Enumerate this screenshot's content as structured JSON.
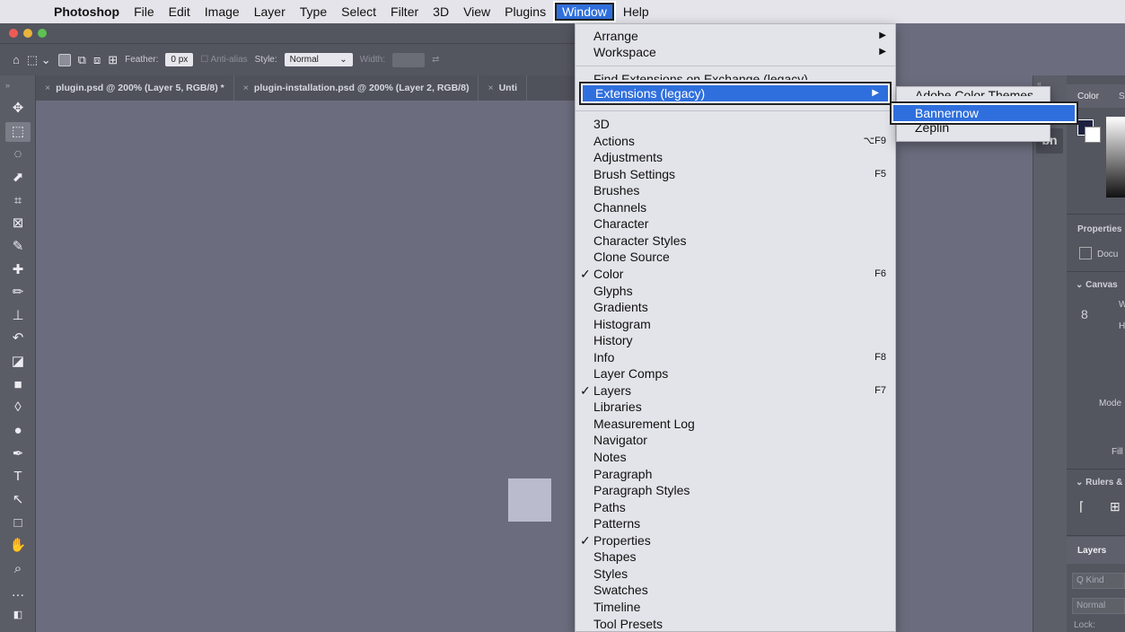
{
  "menubar": {
    "app_name": "Photoshop",
    "items": [
      "File",
      "Edit",
      "Image",
      "Layer",
      "Type",
      "Select",
      "Filter",
      "3D",
      "View",
      "Plugins",
      "Window",
      "Help"
    ]
  },
  "options_bar": {
    "feather_label": "Feather:",
    "feather_value": "0 px",
    "anti_alias_label": "Anti-alias",
    "style_label": "Style:",
    "style_value": "Normal",
    "width_label": "Width:"
  },
  "tabs": [
    "plugin.psd @ 200% (Layer 5, RGB/8) *",
    "plugin-installation.psd @ 200% (Layer 2, RGB/8)",
    "Unti"
  ],
  "window_menu": {
    "arrange": "Arrange",
    "workspace": "Workspace",
    "find_extensions": "Find Extensions on Exchange (legacy)...",
    "extensions_legacy": "Extensions (legacy)",
    "items": [
      {
        "label": "3D",
        "shortcut": "",
        "checked": false
      },
      {
        "label": "Actions",
        "shortcut": "⌥F9",
        "checked": false
      },
      {
        "label": "Adjustments",
        "shortcut": "",
        "checked": false
      },
      {
        "label": "Brush Settings",
        "shortcut": "F5",
        "checked": false
      },
      {
        "label": "Brushes",
        "shortcut": "",
        "checked": false
      },
      {
        "label": "Channels",
        "shortcut": "",
        "checked": false
      },
      {
        "label": "Character",
        "shortcut": "",
        "checked": false
      },
      {
        "label": "Character Styles",
        "shortcut": "",
        "checked": false
      },
      {
        "label": "Clone Source",
        "shortcut": "",
        "checked": false
      },
      {
        "label": "Color",
        "shortcut": "F6",
        "checked": true
      },
      {
        "label": "Glyphs",
        "shortcut": "",
        "checked": false
      },
      {
        "label": "Gradients",
        "shortcut": "",
        "checked": false
      },
      {
        "label": "Histogram",
        "shortcut": "",
        "checked": false
      },
      {
        "label": "History",
        "shortcut": "",
        "checked": false
      },
      {
        "label": "Info",
        "shortcut": "F8",
        "checked": false
      },
      {
        "label": "Layer Comps",
        "shortcut": "",
        "checked": false
      },
      {
        "label": "Layers",
        "shortcut": "F7",
        "checked": true
      },
      {
        "label": "Libraries",
        "shortcut": "",
        "checked": false
      },
      {
        "label": "Measurement Log",
        "shortcut": "",
        "checked": false
      },
      {
        "label": "Navigator",
        "shortcut": "",
        "checked": false
      },
      {
        "label": "Notes",
        "shortcut": "",
        "checked": false
      },
      {
        "label": "Paragraph",
        "shortcut": "",
        "checked": false
      },
      {
        "label": "Paragraph Styles",
        "shortcut": "",
        "checked": false
      },
      {
        "label": "Paths",
        "shortcut": "",
        "checked": false
      },
      {
        "label": "Patterns",
        "shortcut": "",
        "checked": false
      },
      {
        "label": "Properties",
        "shortcut": "",
        "checked": true
      },
      {
        "label": "Shapes",
        "shortcut": "",
        "checked": false
      },
      {
        "label": "Styles",
        "shortcut": "",
        "checked": false
      },
      {
        "label": "Swatches",
        "shortcut": "",
        "checked": false
      },
      {
        "label": "Timeline",
        "shortcut": "",
        "checked": false
      },
      {
        "label": "Tool Presets",
        "shortcut": "",
        "checked": false
      }
    ]
  },
  "extensions_submenu": {
    "items": [
      "Adobe Color Themes",
      "Bannernow",
      "Zeplin"
    ]
  },
  "right_panel": {
    "color_tab": "Color",
    "swatches_tab_partial": "S",
    "properties_title": "Properties",
    "document_label": "Docu",
    "canvas_section": "Canvas",
    "w_label": "W",
    "h_label": "H",
    "mode_label": "Mode",
    "fill_label": "Fill",
    "rulers_section": "Rulers &",
    "layers_tab": "Layers",
    "kind_placeholder": "Q Kind",
    "blend_mode": "Normal",
    "lock_label": "Lock:",
    "panel_icon_text": "bn"
  },
  "colors": {
    "highlight": "#2f6fdd",
    "menu_bg": "#e3e3ea",
    "canvas_bg": "#6b6d7e"
  }
}
